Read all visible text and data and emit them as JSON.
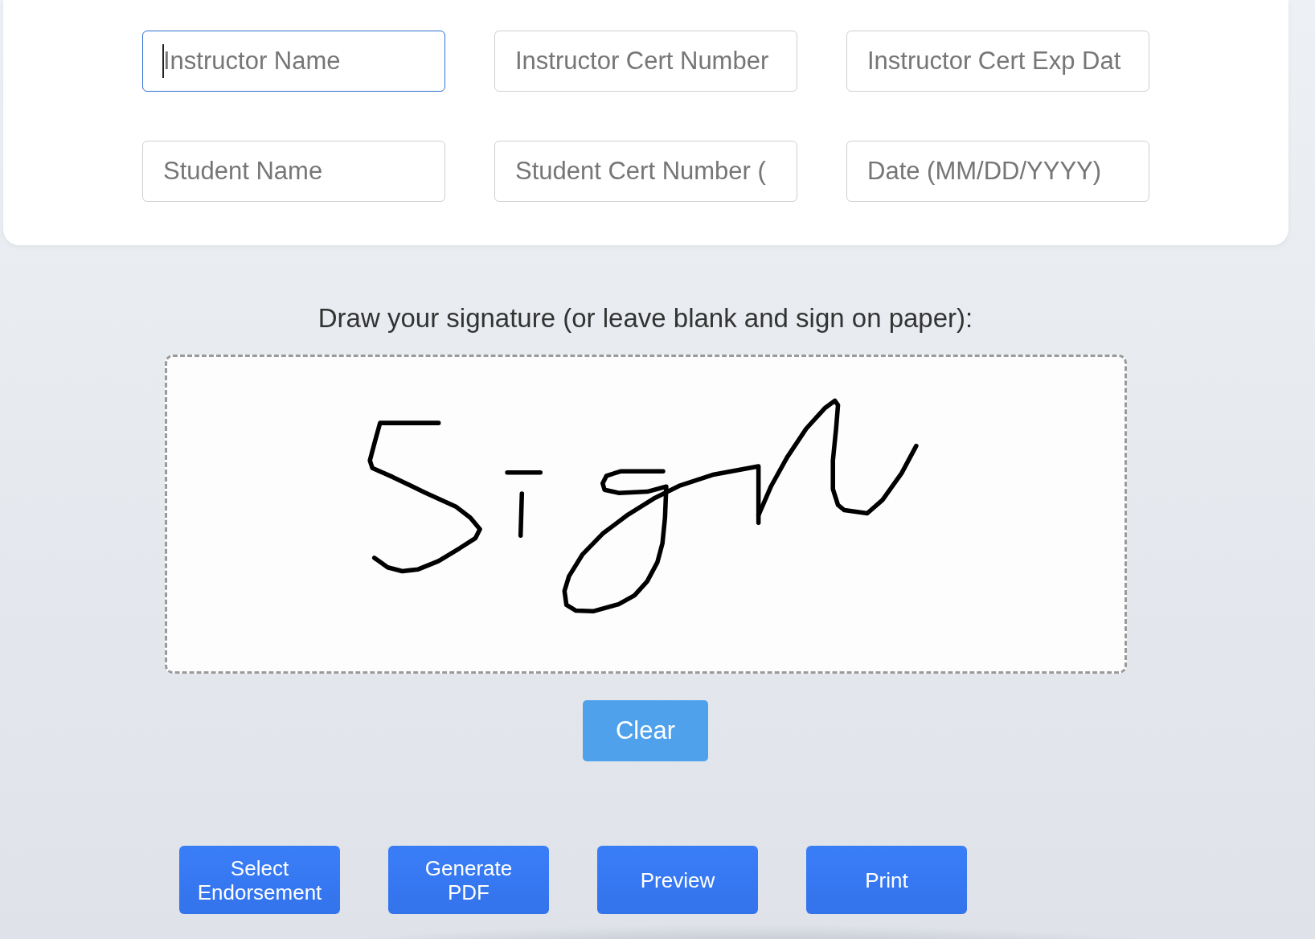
{
  "form": {
    "fields": [
      {
        "placeholder": "Instructor Name",
        "focused": true
      },
      {
        "placeholder": "Instructor Cert Number",
        "focused": false
      },
      {
        "placeholder": "Instructor Cert Exp Dat",
        "focused": false
      },
      {
        "placeholder": "Student Name",
        "focused": false
      },
      {
        "placeholder": "Student Cert Number (",
        "focused": false
      },
      {
        "placeholder": "Date (MM/DD/YYYY)",
        "focused": false
      }
    ]
  },
  "signature": {
    "label": "Draw your signature (or leave blank and sign on paper):",
    "clear_button": "Clear"
  },
  "actions": [
    "Select Endorsement",
    "Generate PDF",
    "Preview",
    "Print"
  ]
}
